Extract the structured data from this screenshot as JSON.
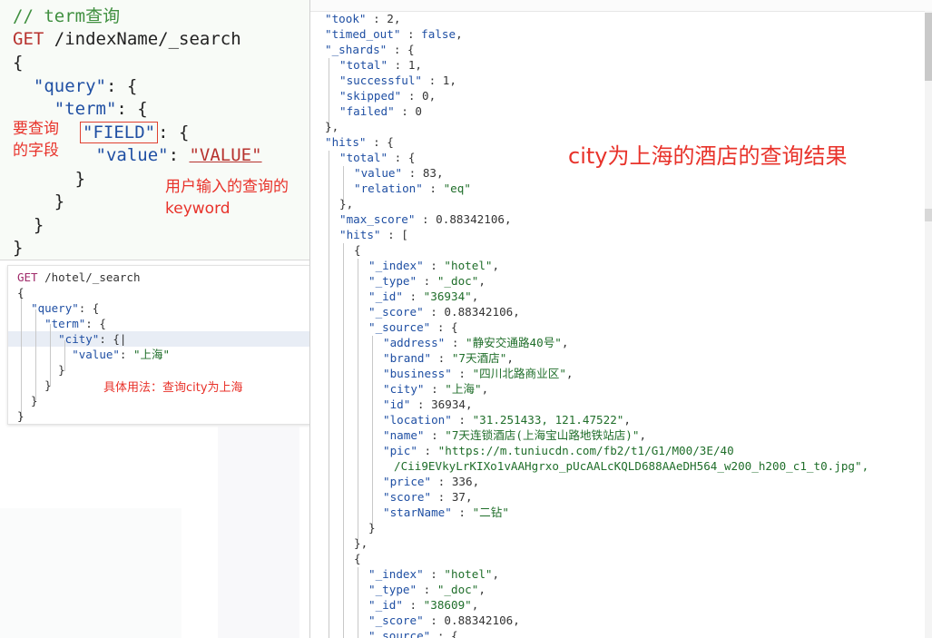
{
  "template": {
    "comment": "// term查询",
    "method": "GET",
    "path": "/indexName/_search",
    "lines": {
      "open": "{",
      "query_key": "\"query\"",
      "term_key": "\"term\"",
      "field": "\"FIELD\"",
      "value_key": "\"value\"",
      "value": "\"VALUE\""
    },
    "note_field": "要查询\n的字段",
    "note_value": "用户输入的查询的\nkeyword"
  },
  "console": {
    "method": "GET",
    "path": "/hotel/_search",
    "query_key": "\"query\"",
    "term_key": "\"term\"",
    "city_key": "\"city\"",
    "value_key": "\"value\"",
    "value": "\"上海\"",
    "note": "具体用法：查询city为上海"
  },
  "response": {
    "headline": "city为上海的酒店的查询结果",
    "took": "2",
    "timed_out": "false",
    "shards": {
      "total": "1",
      "successful": "1",
      "skipped": "0",
      "failed": "0"
    },
    "hits_total": {
      "value": "83",
      "relation": "\"eq\""
    },
    "max_score": "0.88342106",
    "hit1": {
      "index": "\"hotel\"",
      "type": "\"_doc\"",
      "id": "\"36934\"",
      "score": "0.88342106",
      "source": {
        "address": "\"静安交通路40号\"",
        "brand": "\"7天酒店\"",
        "business": "\"四川北路商业区\"",
        "city": "\"上海\"",
        "id": "36934",
        "location": "\"31.251433, 121.47522\"",
        "name": "\"7天连锁酒店(上海宝山路地铁站店)\"",
        "pic_1": "\"https://m.tuniucdn.com/fb2/t1/G1/M00/3E/40",
        "pic_2": "/Cii9EVkyLrKIXo1vAAHgrxo_pUcAALcKQLD688AAeDH564_w200_h200_c1_t0.jpg\",",
        "price": "336",
        "score": "37",
        "starName": "\"二钻\""
      }
    },
    "hit2": {
      "index": "\"hotel\"",
      "type": "\"_doc\"",
      "id": "\"38609\"",
      "score": "0.88342106"
    }
  }
}
